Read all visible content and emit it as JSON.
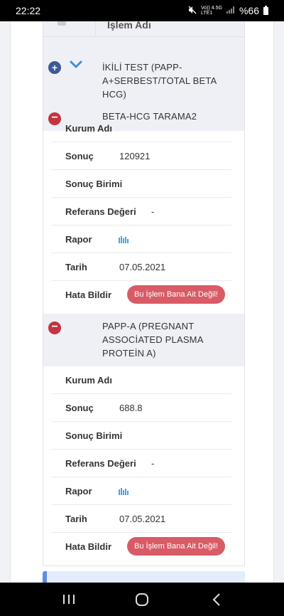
{
  "status_bar": {
    "time": "22:22",
    "network_top": "Vo)) 4.5G",
    "network_bottom": "LTE1",
    "battery": "%66",
    "icons": [
      "mute-icon",
      "signal-icon",
      "battery-icon"
    ]
  },
  "table": {
    "header_title": "İşlem Adı"
  },
  "parent": {
    "name": "İKİLİ TEST (PAPP-A+SERBEST/TOTAL BETA HCG)"
  },
  "items": [
    {
      "title": "BETA-HCG TARAMA2",
      "rows": {
        "kurum_label": "Kurum Adı",
        "kurum_value": "",
        "sonuc_label": "Sonuç",
        "sonuc_value": "120921",
        "birim_label": "Sonuç Birimi",
        "birim_value": "",
        "referans_label": "Referans Değeri",
        "referans_value": "-",
        "rapor_label": "Rapor",
        "tarih_label": "Tarih",
        "tarih_value": "07.05.2021",
        "hata_label": "Hata Bildir",
        "hata_button": "Bu İşlem Bana Ait Değil!"
      }
    },
    {
      "title": "PAPP-A (PREGNANT ASSOCİATED PLASMA PROTEİN A)",
      "rows": {
        "kurum_label": "Kurum Adı",
        "kurum_value": "",
        "sonuc_label": "Sonuç",
        "sonuc_value": "688.8",
        "birim_label": "Sonuç Birimi",
        "birim_value": "",
        "referans_label": "Referans Değeri",
        "referans_value": "-",
        "rapor_label": "Rapor",
        "tarih_label": "Tarih",
        "tarih_value": "07.05.2021",
        "hata_label": "Hata Bildir",
        "hata_button": "Bu İşlem Bana Ait Değil!"
      }
    }
  ],
  "colors": {
    "header_bg": "#eef0f5",
    "minus": "#c4333f",
    "plus": "#3d5a96",
    "chevron": "#3b8fd6",
    "report_button": "#d85b66",
    "chart_icon": "#4aa3df"
  },
  "nav_bar": {
    "icons": [
      "recent-apps-icon",
      "home-icon",
      "back-icon"
    ]
  }
}
